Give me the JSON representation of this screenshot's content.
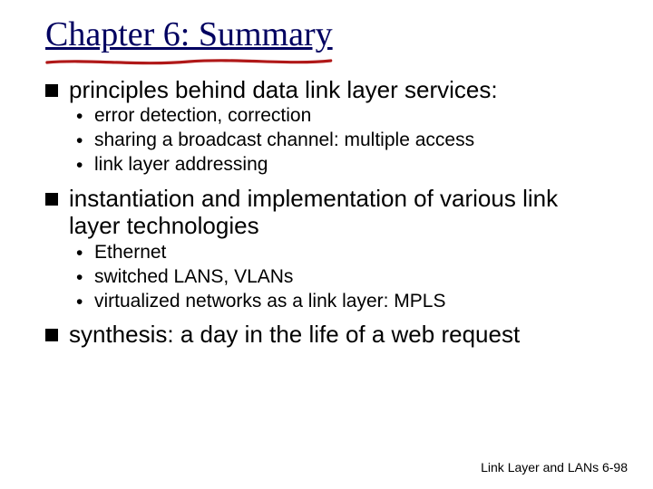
{
  "title": "Chapter 6: Summary",
  "bullets": [
    {
      "text": "principles behind data link layer services:",
      "sub": [
        "error detection, correction",
        "sharing a broadcast channel: multiple access",
        "link layer addressing"
      ]
    },
    {
      "text": "instantiation and implementation of various link layer technologies",
      "sub": [
        "Ethernet",
        "switched LANS, VLANs",
        "virtualized networks as a link layer: MPLS"
      ]
    },
    {
      "text": "synthesis: a day in the life of a web request",
      "sub": []
    }
  ],
  "footer": "Link Layer and LANs   6-98"
}
